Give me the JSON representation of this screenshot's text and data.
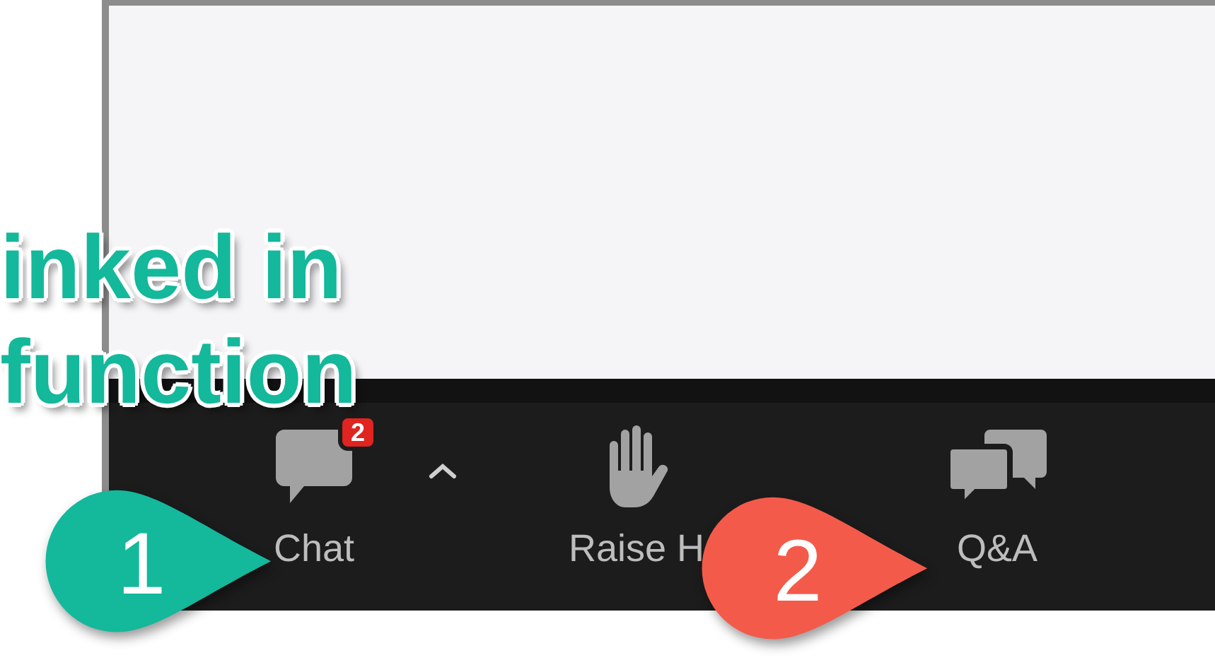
{
  "toolbar": {
    "items": [
      {
        "kind": "chat",
        "label": "Chat",
        "badge": "2",
        "has_menu": true
      },
      {
        "kind": "hand",
        "label": "Raise H",
        "has_menu": false
      },
      {
        "kind": "qa",
        "label": "Q&A",
        "has_menu": false
      }
    ]
  },
  "annotation": {
    "text": "inked in function"
  },
  "callouts": [
    {
      "number": "1",
      "color": "#14b89b"
    },
    {
      "number": "2",
      "color": "#f45a4a"
    }
  ]
}
